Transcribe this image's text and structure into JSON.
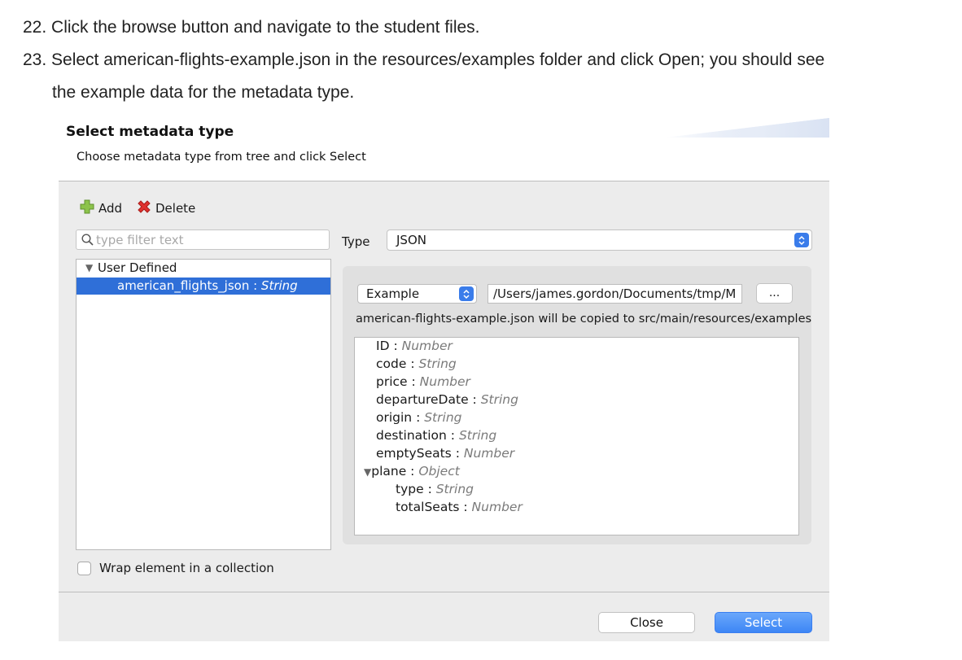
{
  "instructions": {
    "step22": "22. Click the browse button and navigate to the student files.",
    "step23_line1": "23. Select american-flights-example.json in the resources/examples folder and click Open; you should see",
    "step23_line2": "the example data for the metadata type."
  },
  "dialog": {
    "title": "Select metadata type",
    "subtitle": "Choose metadata type from tree and click Select",
    "toolbar": {
      "add_label": "Add",
      "delete_label": "Delete"
    },
    "filter": {
      "placeholder": "type filter text",
      "value": ""
    },
    "tree": {
      "group_label": "User Defined",
      "selected_item": {
        "name": "american_flights_json",
        "separator": " : ",
        "type": "String"
      }
    },
    "type_label": "Type",
    "type_value": "JSON",
    "source_select": "Example",
    "path_value": "/Users/james.gordon/Documents/tmp/M",
    "browse_label": "...",
    "copy_note": "american-flights-example.json will be copied to src/main/resources/examples",
    "fields": [
      {
        "name": "ID",
        "type": "Number"
      },
      {
        "name": "code",
        "type": "String"
      },
      {
        "name": "price",
        "type": "Number"
      },
      {
        "name": "departureDate",
        "type": "String"
      },
      {
        "name": "origin",
        "type": "String"
      },
      {
        "name": "destination",
        "type": "String"
      },
      {
        "name": "emptySeats",
        "type": "Number"
      },
      {
        "name": "plane",
        "type": "Object"
      },
      {
        "name": "type",
        "type": "String"
      },
      {
        "name": "totalSeats",
        "type": "Number"
      }
    ],
    "wrap_label": "Wrap element in a collection",
    "wrap_checked": false,
    "close_label": "Close",
    "select_label": "Select"
  },
  "colors": {
    "selection": "#2f6fd8",
    "primary_button": "#3d86f5",
    "add_icon": "#8cc34b",
    "delete_icon": "#e0312e"
  }
}
